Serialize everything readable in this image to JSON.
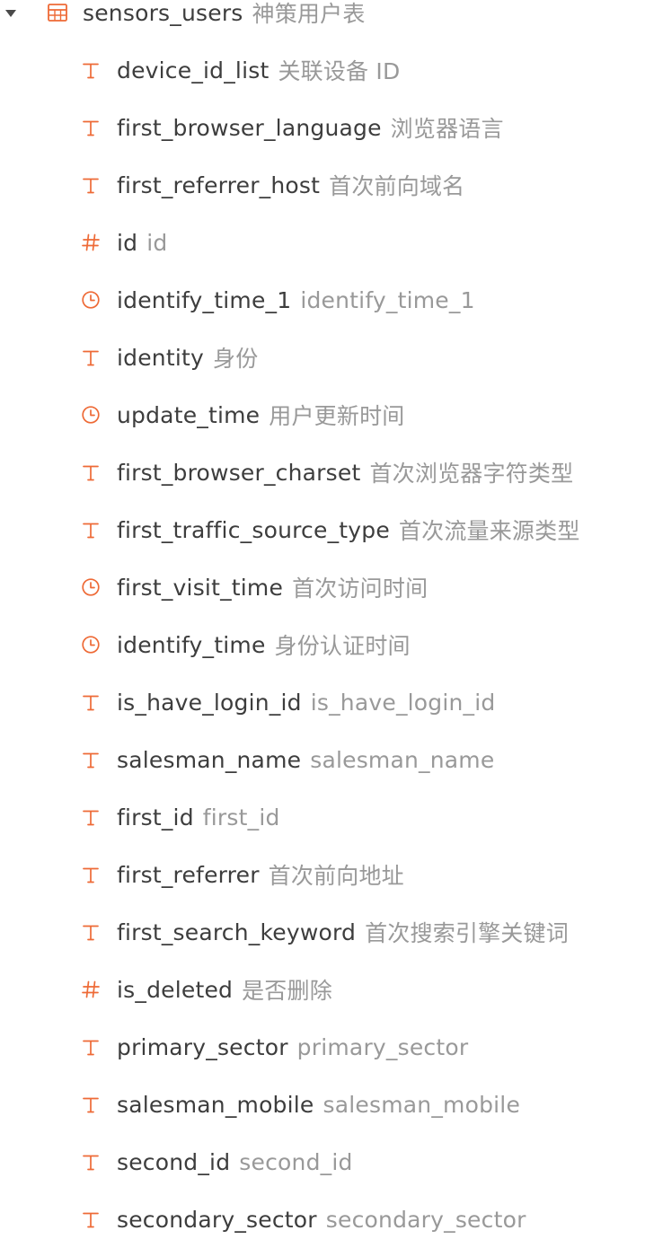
{
  "table": {
    "name": "sensors_users",
    "comment": "神策用户表",
    "icon": "table-icon",
    "expanded": true
  },
  "accent_color": "#ee6a36",
  "columns": [
    {
      "name": "device_id_list",
      "comment": "关联设备 ID",
      "type": "text"
    },
    {
      "name": "first_browser_language",
      "comment": "浏览器语言",
      "type": "text"
    },
    {
      "name": "first_referrer_host",
      "comment": "首次前向域名",
      "type": "text"
    },
    {
      "name": "id",
      "comment": "id",
      "type": "number"
    },
    {
      "name": "identify_time_1",
      "comment": "identify_time_1",
      "type": "time"
    },
    {
      "name": "identity",
      "comment": "身份",
      "type": "text"
    },
    {
      "name": "update_time",
      "comment": "用户更新时间",
      "type": "time"
    },
    {
      "name": "first_browser_charset",
      "comment": "首次浏览器字符类型",
      "type": "text"
    },
    {
      "name": "first_traffic_source_type",
      "comment": "首次流量来源类型",
      "type": "text"
    },
    {
      "name": "first_visit_time",
      "comment": "首次访问时间",
      "type": "time"
    },
    {
      "name": "identify_time",
      "comment": "身份认证时间",
      "type": "time"
    },
    {
      "name": "is_have_login_id",
      "comment": "is_have_login_id",
      "type": "text"
    },
    {
      "name": "salesman_name",
      "comment": "salesman_name",
      "type": "text"
    },
    {
      "name": "first_id",
      "comment": "first_id",
      "type": "text"
    },
    {
      "name": "first_referrer",
      "comment": "首次前向地址",
      "type": "text"
    },
    {
      "name": "first_search_keyword",
      "comment": "首次搜索引擎关键词",
      "type": "text"
    },
    {
      "name": "is_deleted",
      "comment": "是否删除",
      "type": "number"
    },
    {
      "name": "primary_sector",
      "comment": "primary_sector",
      "type": "text"
    },
    {
      "name": "salesman_mobile",
      "comment": "salesman_mobile",
      "type": "text"
    },
    {
      "name": "second_id",
      "comment": "second_id",
      "type": "text"
    },
    {
      "name": "secondary_sector",
      "comment": "secondary_sector",
      "type": "text"
    }
  ]
}
